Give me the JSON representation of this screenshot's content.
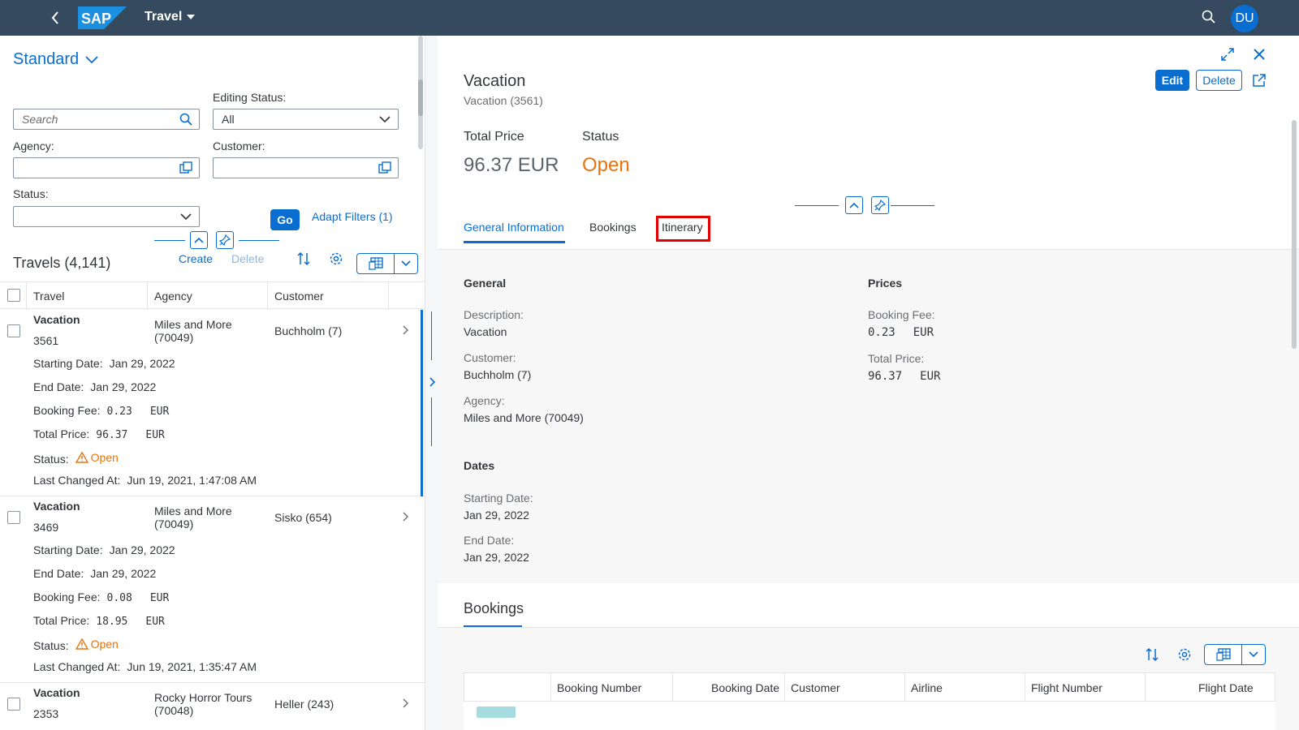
{
  "shell": {
    "app_title": "Travel",
    "avatar": "DU"
  },
  "filter": {
    "variant": "Standard",
    "search_placeholder": "Search",
    "editing_status_label": "Editing Status:",
    "editing_status_value": "All",
    "agency_label": "Agency:",
    "customer_label": "Customer:",
    "status_label": "Status:",
    "go": "Go",
    "adapt": "Adapt Filters (1)"
  },
  "list": {
    "title": "Travels (4,141)",
    "create": "Create",
    "delete": "Delete",
    "columns": [
      "Travel",
      "Agency",
      "Customer"
    ],
    "labels": {
      "start": "Starting Date:",
      "end": "End Date:",
      "fee": "Booking Fee:",
      "total": "Total Price:",
      "status": "Status:",
      "changed": "Last Changed At:"
    },
    "rows": [
      {
        "title": "Vacation",
        "id": "3561",
        "agency1": "Miles and More",
        "agency2": "(70049)",
        "customer": "Buchholm (7)",
        "start": "Jan 29, 2022",
        "end": "Jan 29, 2022",
        "fee": "0.23",
        "fee_cur": "EUR",
        "total": "96.37",
        "total_cur": "EUR",
        "status": "Open",
        "changed": "Jun 19, 2021, 1:47:08 AM"
      },
      {
        "title": "Vacation",
        "id": "3469",
        "agency1": "Miles and More",
        "agency2": "(70049)",
        "customer": "Sisko (654)",
        "start": "Jan 29, 2022",
        "end": "Jan 29, 2022",
        "fee": "0.08",
        "fee_cur": "EUR",
        "total": "18.95",
        "total_cur": "EUR",
        "status": "Open",
        "changed": "Jun 19, 2021, 1:35:47 AM"
      },
      {
        "title": "Vacation",
        "id": "2353",
        "agency1": "Rocky Horror Tours",
        "agency2": "(70048)",
        "customer": "Heller (243)"
      }
    ]
  },
  "detail": {
    "title": "Vacation",
    "subtitle": "Vacation (3561)",
    "edit": "Edit",
    "delete": "Delete",
    "kpi_price_label": "Total Price",
    "kpi_price_value": "96.37 EUR",
    "kpi_status_label": "Status",
    "kpi_status_value": "Open",
    "tabs": [
      "General Information",
      "Bookings",
      "Itinerary"
    ],
    "general": {
      "head": "General",
      "desc_label": "Description:",
      "desc_value": "Vacation",
      "cust_label": "Customer:",
      "cust_value": "Buchholm (7)",
      "agency_label": "Agency:",
      "agency_value": "Miles and More (70049)"
    },
    "prices": {
      "head": "Prices",
      "fee_label": "Booking Fee:",
      "fee_value": "0.23",
      "fee_cur": "EUR",
      "total_label": "Total Price:",
      "total_value": "96.37",
      "total_cur": "EUR"
    },
    "dates": {
      "head": "Dates",
      "start_label": "Starting Date:",
      "start_value": "Jan 29, 2022",
      "end_label": "End Date:",
      "end_value": "Jan 29, 2022"
    },
    "bookings": {
      "head": "Bookings",
      "columns": [
        "Booking Number",
        "Booking Date",
        "Customer",
        "Airline",
        "Flight Number",
        "Flight Date"
      ]
    }
  },
  "colors": {
    "shell": "#354a5f",
    "accent": "#0a6ed1",
    "warning": "#e9730c",
    "highlight": "#e00000"
  }
}
